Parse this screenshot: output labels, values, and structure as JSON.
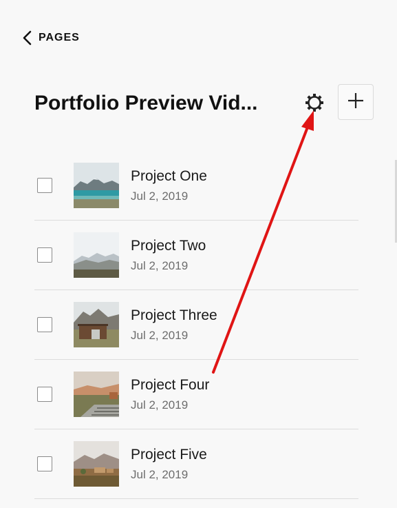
{
  "nav": {
    "back_label": "PAGES",
    "back_icon": "chevron-left-icon"
  },
  "header": {
    "title": "Portfolio Preview Vid...",
    "settings_icon": "gear-icon",
    "add_icon": "plus-icon"
  },
  "projects": [
    {
      "title": "Project One",
      "date": "Jul 2, 2019",
      "thumb": "lake-mountains"
    },
    {
      "title": "Project Two",
      "date": "Jul 2, 2019",
      "thumb": "snowy-hills"
    },
    {
      "title": "Project Three",
      "date": "Jul 2, 2019",
      "thumb": "cabin-mountains"
    },
    {
      "title": "Project Four",
      "date": "Jul 2, 2019",
      "thumb": "terraced-steps"
    },
    {
      "title": "Project Five",
      "date": "Jul 2, 2019",
      "thumb": "desert-village"
    }
  ],
  "annotation": {
    "arrow_color": "#e01515",
    "points_to": "settings-gear"
  },
  "colors": {
    "background": "#f8f8f8",
    "divider": "#dcdcdc",
    "date_text": "#6d6d6d"
  }
}
